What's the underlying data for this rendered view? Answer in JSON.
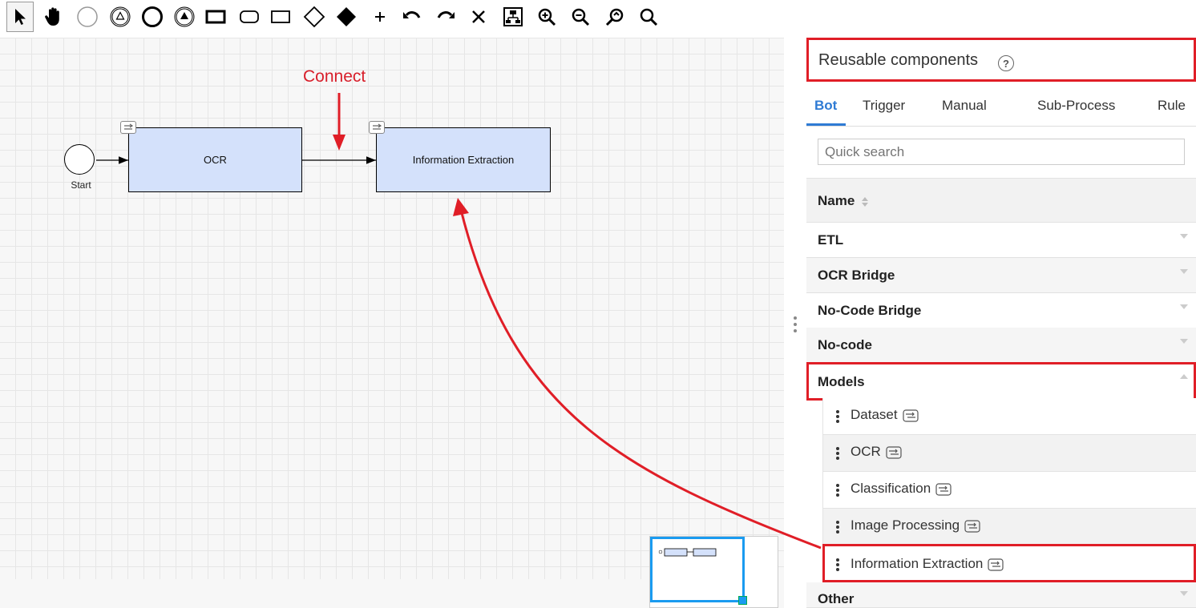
{
  "toolbar": {
    "tools": [
      {
        "icon": "pointer-icon",
        "active": true
      },
      {
        "icon": "hand-pan-icon"
      },
      {
        "icon": "start-event-icon"
      },
      {
        "icon": "intermediate-signal-event-icon"
      },
      {
        "icon": "end-event-icon"
      },
      {
        "icon": "signal-end-event-icon"
      },
      {
        "icon": "task-icon"
      },
      {
        "icon": "subprocess-icon"
      },
      {
        "icon": "group-rectangle-icon"
      },
      {
        "icon": "exclusive-gateway-icon"
      },
      {
        "icon": "filled-gateway-icon"
      },
      {
        "icon": "add-icon"
      },
      {
        "icon": "undo-icon"
      },
      {
        "icon": "redo-icon"
      },
      {
        "icon": "delete-icon"
      },
      {
        "icon": "auto-layout-icon"
      },
      {
        "icon": "zoom-in-icon"
      },
      {
        "icon": "zoom-out-icon"
      },
      {
        "icon": "zoom-fit-icon"
      },
      {
        "icon": "zoom-reset-icon"
      }
    ]
  },
  "canvas": {
    "start_label": "Start",
    "task_ocr": "OCR",
    "task_info_extraction": "Information Extraction",
    "annotation_connect": "Connect"
  },
  "panel": {
    "title": "Reusable components",
    "tabs": [
      {
        "label": "Bot",
        "active": true
      },
      {
        "label": "Trigger"
      },
      {
        "label": "Manual"
      },
      {
        "label": "Sub-Process"
      },
      {
        "label": "Rule"
      }
    ],
    "search": {
      "placeholder": "Quick search",
      "value": ""
    },
    "column_header": "Name",
    "groups": [
      {
        "label": "ETL",
        "expanded": false
      },
      {
        "label": "OCR Bridge",
        "expanded": false
      },
      {
        "label": "No-Code Bridge",
        "expanded": false
      },
      {
        "label": "No-code",
        "expanded": false
      },
      {
        "label": "Models",
        "expanded": true
      },
      {
        "label": "Other",
        "expanded": false
      }
    ],
    "model_items": [
      {
        "label": "Dataset"
      },
      {
        "label": "OCR"
      },
      {
        "label": "Classification"
      },
      {
        "label": "Image Processing"
      },
      {
        "label": "Information Extraction"
      }
    ]
  },
  "colors": {
    "highlight": "#e01e27",
    "accent": "#2f7bd4",
    "task_fill": "#d4e1fb",
    "minimap_frame": "#1a9bf0"
  }
}
